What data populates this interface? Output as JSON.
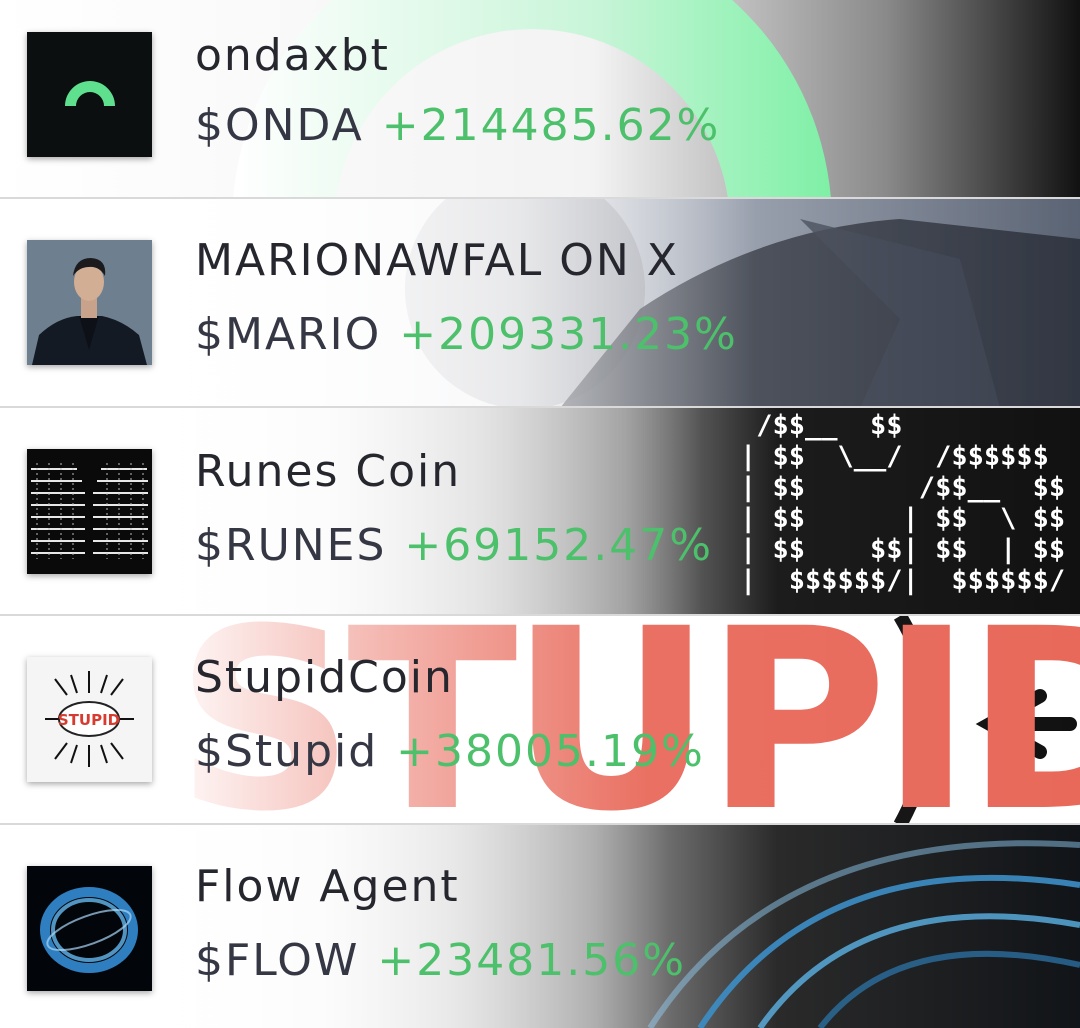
{
  "tokens": [
    {
      "name": "ondaxbt",
      "ticker": "$ONDA",
      "change": "+214485.62%"
    },
    {
      "name": "MARIONAWFAL ON X",
      "ticker": "$MARIO",
      "change": "+209331.23%"
    },
    {
      "name": "Runes Coin",
      "ticker": "$RUNES",
      "change": "+69152.47%"
    },
    {
      "name": "StupidCoin",
      "ticker": "$Stupid",
      "change": "+38005.19%"
    },
    {
      "name": "Flow Agent",
      "ticker": "$FLOW",
      "change": "+23481.56%"
    }
  ],
  "stupid_logo_text": "STUPID",
  "colors": {
    "positive": "#4cc06a",
    "text": "#26272e",
    "onda_green": "#5ee08e"
  }
}
